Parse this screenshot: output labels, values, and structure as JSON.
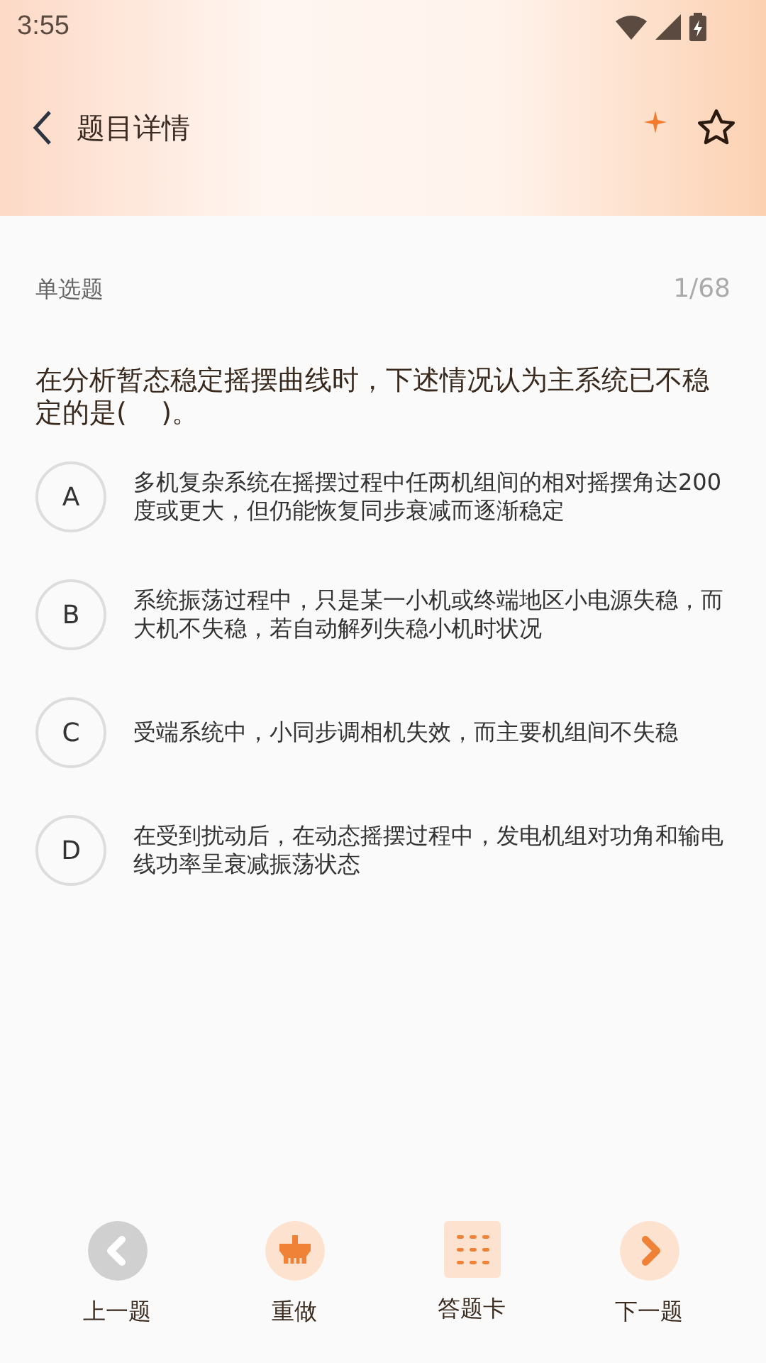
{
  "status_bar": {
    "time": "3:55"
  },
  "header": {
    "title": "题目详情",
    "favorited": false
  },
  "question": {
    "type": "单选题",
    "progress": "1/68",
    "text": "在分析暂态稳定摇摆曲线时，下述情况认为主系统已不稳定的是(    )。",
    "options": [
      {
        "letter": "A",
        "text": "多机复杂系统在摇摆过程中任两机组间的相对摇摆角达200度或更大，但仍能恢复同步衰减而逐渐稳定",
        "selected": false
      },
      {
        "letter": "B",
        "text": "系统振荡过程中，只是某一小机或终端地区小电源失稳，而大机不失稳，若自动解列失稳小机时状况",
        "selected": false
      },
      {
        "letter": "C",
        "text": "受端系统中，小同步调相机失效，而主要机组间不失稳",
        "selected": false
      },
      {
        "letter": "D",
        "text": "在受到扰动后，在动态摇摆过程中，发电机组对功角和输电线功率呈衰减振荡状态",
        "selected": false
      }
    ]
  },
  "bottom_nav": [
    {
      "kind": "prev",
      "label": "上一题",
      "disabled": true
    },
    {
      "kind": "redo",
      "label": "重做",
      "disabled": false
    },
    {
      "kind": "card",
      "label": "答题卡",
      "disabled": false
    },
    {
      "kind": "next",
      "label": "下一题",
      "disabled": false
    }
  ]
}
